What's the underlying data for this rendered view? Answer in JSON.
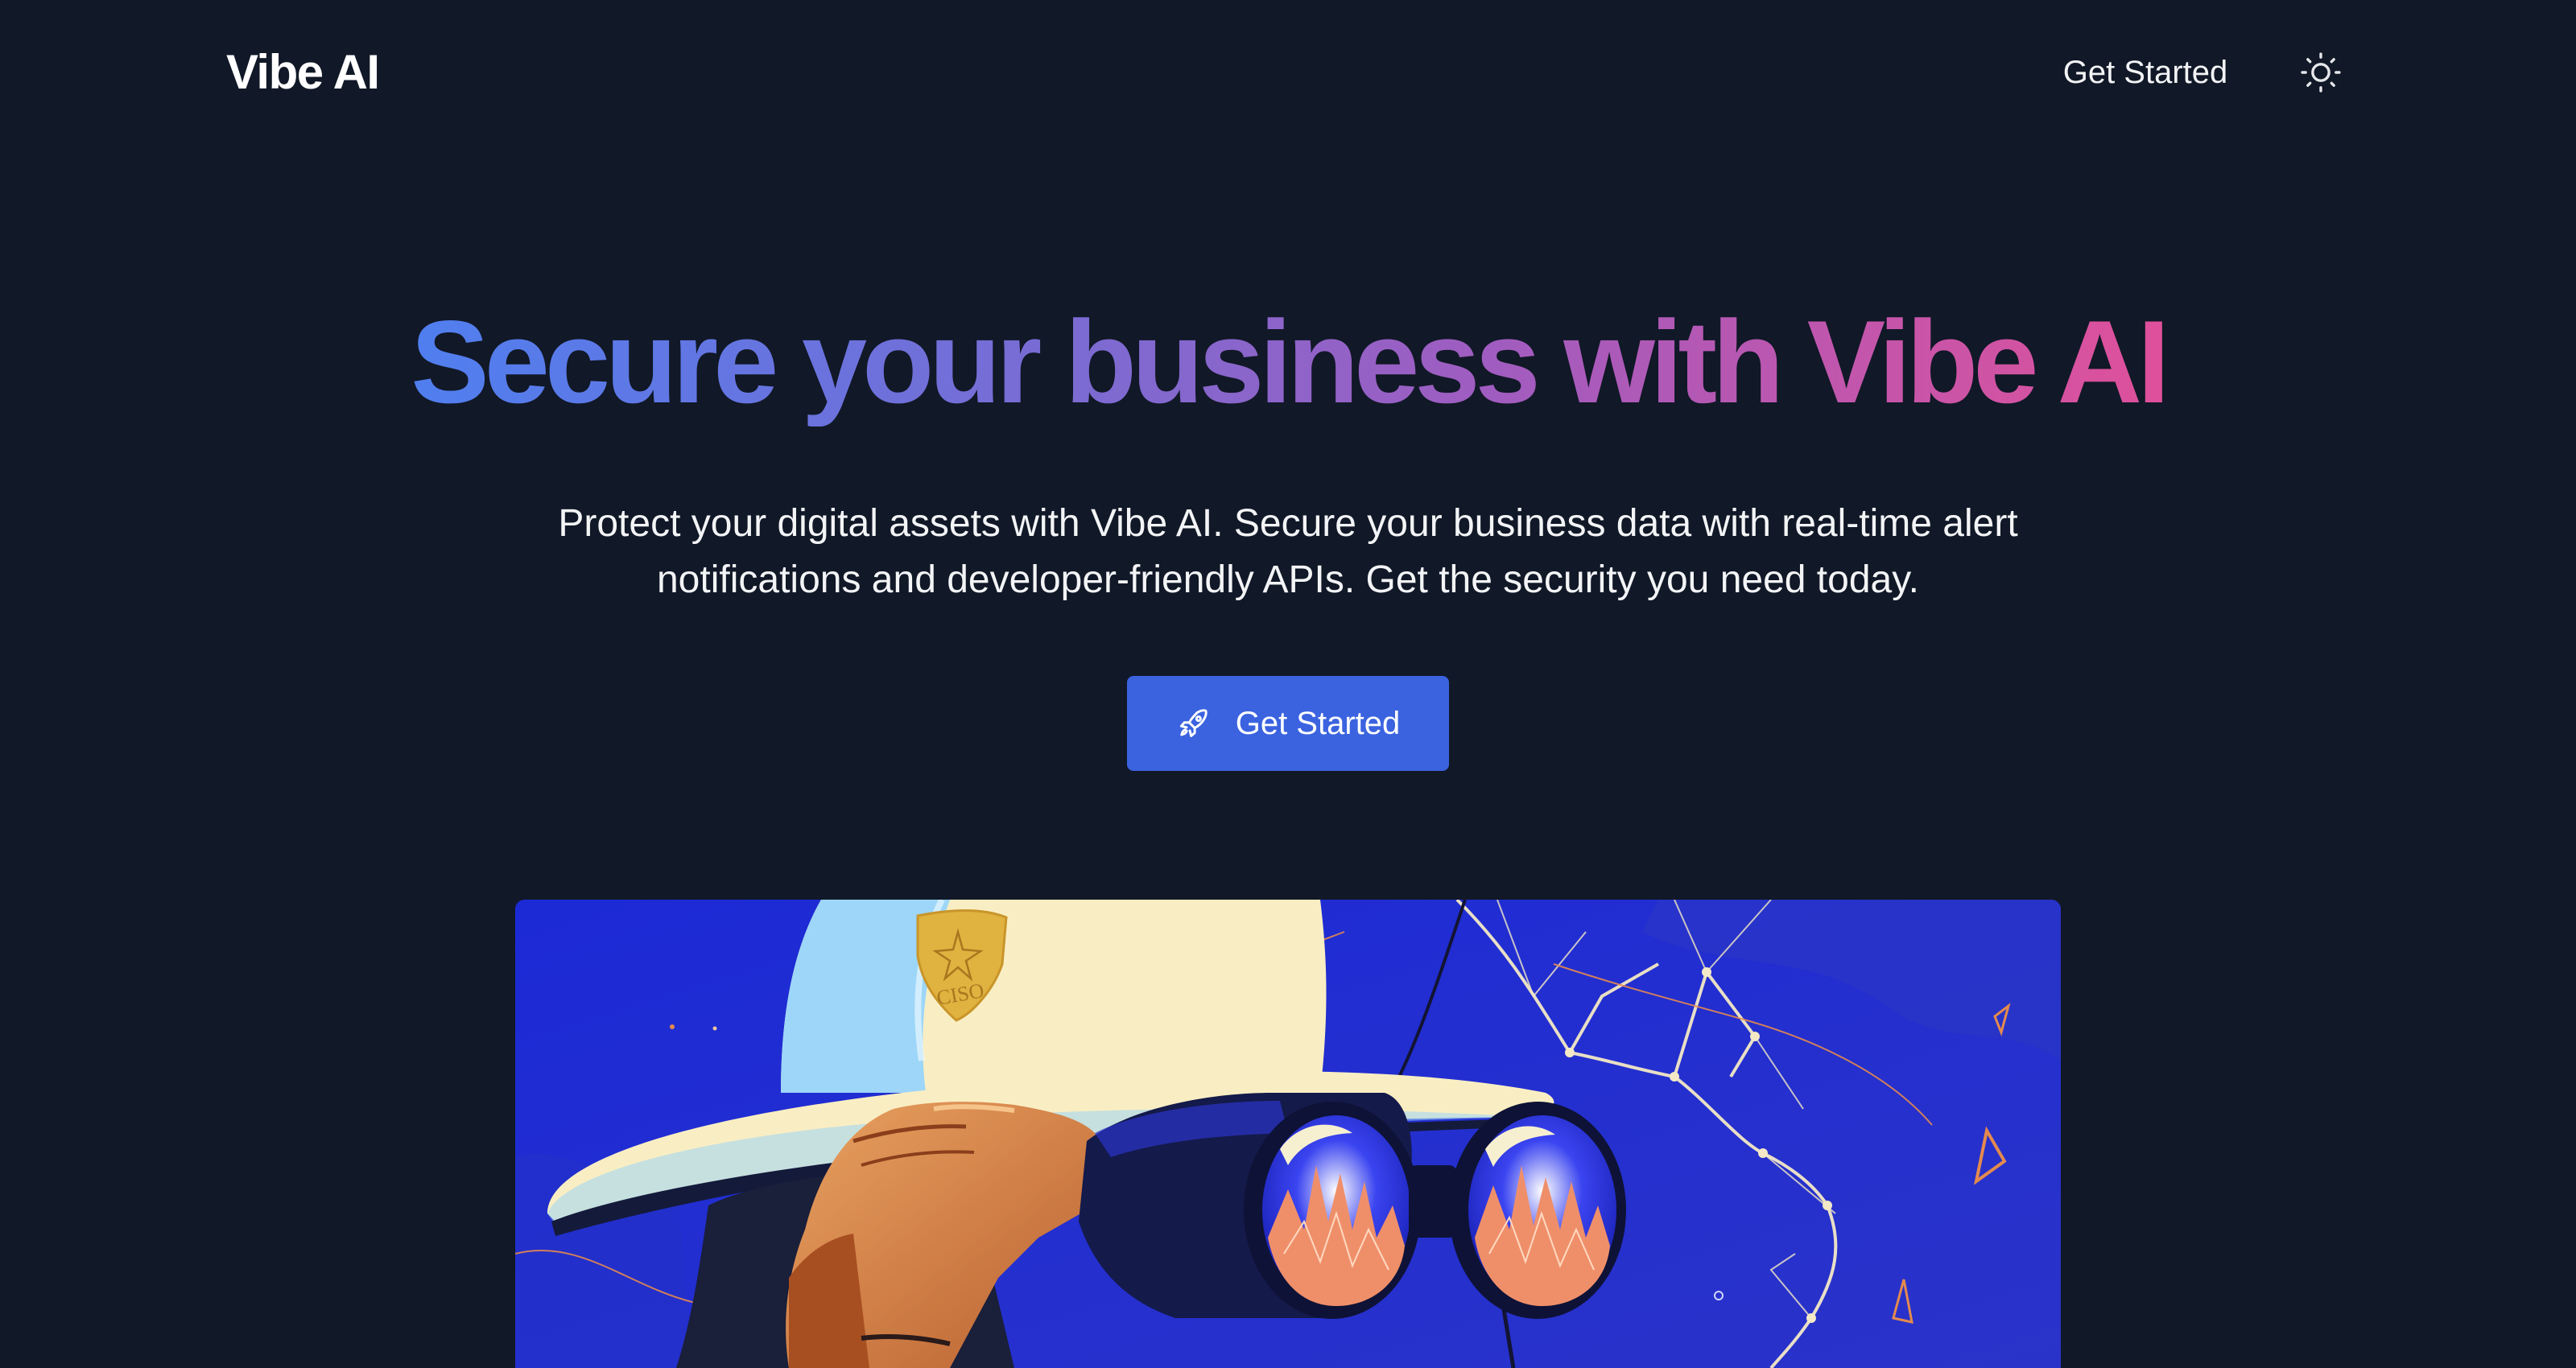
{
  "header": {
    "logo": "Vibe AI",
    "nav_get_started": "Get Started",
    "theme_toggle_icon": "sun-icon"
  },
  "hero": {
    "title": "Secure your business with Vibe AI",
    "title_gradient": [
      "#4f7ff0",
      "#7b6bd2",
      "#a15cbf",
      "#e0509a"
    ],
    "subtitle": "Protect your digital assets with Vibe AI. Secure your business data with real-time alert notifications and developer-friendly APIs. Get the security you need today.",
    "cta": {
      "label": "Get Started",
      "icon": "rocket-icon",
      "color": "#3b63e0"
    },
    "illustration": {
      "badge_text": "CISO"
    }
  },
  "colors": {
    "background": "#111827",
    "text": "#ffffff"
  }
}
